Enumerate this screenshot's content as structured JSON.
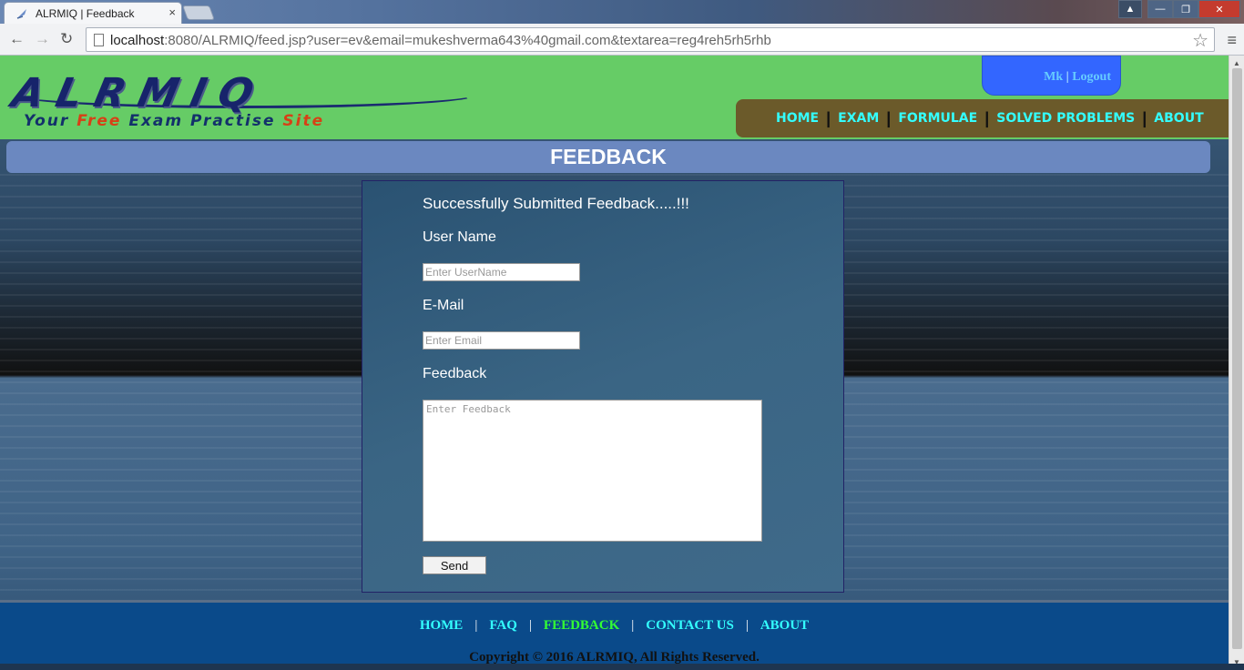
{
  "browser": {
    "tab_title": "ALRMIQ | Feedback",
    "tab_close": "×",
    "url_host": "localhost",
    "url_rest": ":8080/ALRMIQ/feed.jsp?user=ev&email=mukeshverma643%40gmail.com&textarea=reg4reh5rh5rhb",
    "back": "←",
    "forward": "→",
    "reload": "↻",
    "star": "☆",
    "menu": "≡",
    "win_min": "—",
    "win_max": "❐",
    "win_close": "✕",
    "win_user": "▲"
  },
  "header": {
    "logo_text": "ALRMIQ",
    "tagline_parts": [
      "Your ",
      "Free",
      " Exam Practise ",
      "Site"
    ],
    "user_name": "Mk",
    "user_sep": "|",
    "logout": "Logout",
    "nav": [
      "HOME",
      "EXAM",
      "FORMULAE",
      "SOLVED PROBLEMS",
      "ABOUT"
    ],
    "nav_sep": "|"
  },
  "page": {
    "title": "FEEDBACK"
  },
  "form": {
    "success_message": "Successfully Submitted Feedback.....!!!",
    "username_label": "User Name",
    "username_placeholder": "Enter UserName",
    "email_label": "E-Mail",
    "email_placeholder": "Enter Email",
    "feedback_label": "Feedback",
    "feedback_placeholder": "Enter Feedback",
    "send_label": "Send"
  },
  "footer": {
    "nav": [
      "HOME",
      "FAQ",
      "FEEDBACK",
      "CONTACT US",
      "ABOUT"
    ],
    "active": "FEEDBACK",
    "sep": "|",
    "copyright": "Copyright © 2016 ALRMIQ, All Rights Reserved."
  },
  "colors": {
    "header_green": "#66cc66",
    "nav_cyan": "#33ffff",
    "footer_active_green": "#33ff33",
    "title_bar": "#6b88c0",
    "user_box_blue": "#3366ff"
  }
}
